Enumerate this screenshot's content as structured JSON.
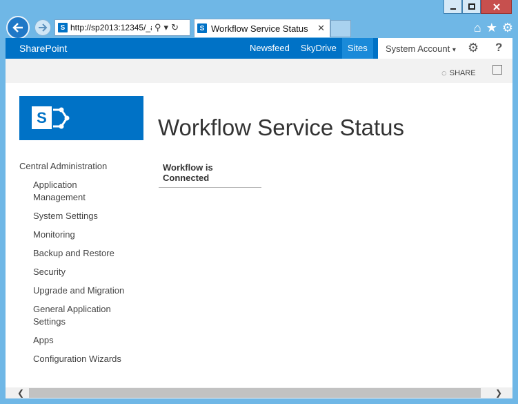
{
  "browser": {
    "address_url": "http://sp2013:12345/_a",
    "tab_title": "Workflow Service Status"
  },
  "suite": {
    "brand": "SharePoint",
    "links": [
      "Newsfeed",
      "SkyDrive",
      "Sites"
    ],
    "active_link": "Sites",
    "user": "System Account",
    "help": "?"
  },
  "ribbon": {
    "share_label": "SHARE"
  },
  "logo": {
    "letter": "S"
  },
  "page": {
    "title": "Workflow Service Status",
    "status": "Workflow is Connected"
  },
  "left_nav": {
    "heading": "Central Administration",
    "items": [
      "Application Management",
      "System Settings",
      "Monitoring",
      "Backup and Restore",
      "Security",
      "Upgrade and Migration",
      "General Application Settings",
      "Apps",
      "Configuration Wizards"
    ]
  },
  "colors": {
    "suite_blue": "#0072c6",
    "window_frame": "#6fb7e6"
  }
}
